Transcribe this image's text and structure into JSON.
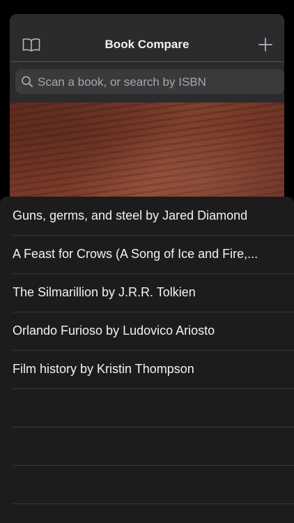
{
  "header": {
    "title": "Book Compare",
    "left_icon": "book-icon",
    "right_icon": "plus-icon"
  },
  "search": {
    "placeholder": "Scan a book, or search by ISBN"
  },
  "results": [
    "Guns, germs, and steel by Jared Diamond",
    "A Feast for Crows (A Song of Ice and Fire,...",
    "The Silmarillion by J.R.R. Tolkien",
    "Orlando Furioso by Ludovico Ariosto",
    "Film history by Kristin Thompson",
    "",
    "",
    ""
  ],
  "colors": {
    "background": "#000000",
    "card": "#2a2a2c",
    "sheet": "#1c1c1e",
    "separator": "#38383a",
    "text": "#f2f2f2",
    "placeholder": "#a7a7ab"
  }
}
